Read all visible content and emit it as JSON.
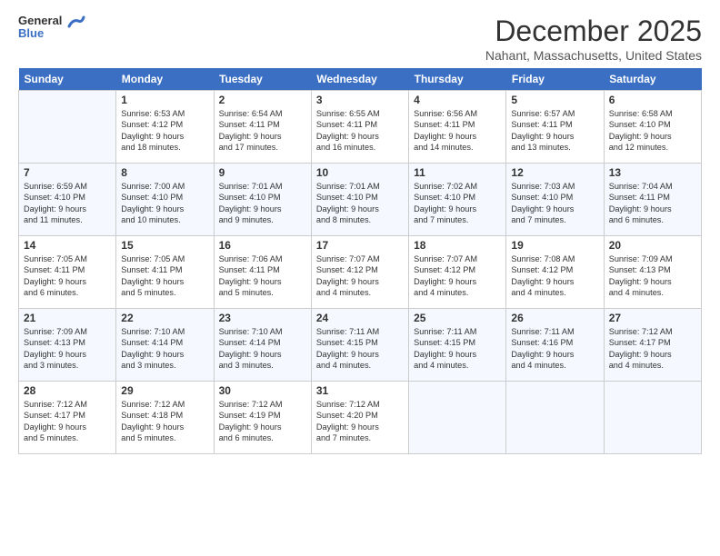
{
  "logo": {
    "general": "General",
    "blue": "Blue"
  },
  "title": "December 2025",
  "location": "Nahant, Massachusetts, United States",
  "days_of_week": [
    "Sunday",
    "Monday",
    "Tuesday",
    "Wednesday",
    "Thursday",
    "Friday",
    "Saturday"
  ],
  "weeks": [
    [
      {
        "day": "",
        "sunrise": "",
        "sunset": "",
        "daylight": ""
      },
      {
        "day": "1",
        "sunrise": "Sunrise: 6:53 AM",
        "sunset": "Sunset: 4:12 PM",
        "daylight": "Daylight: 9 hours and 18 minutes."
      },
      {
        "day": "2",
        "sunrise": "Sunrise: 6:54 AM",
        "sunset": "Sunset: 4:11 PM",
        "daylight": "Daylight: 9 hours and 17 minutes."
      },
      {
        "day": "3",
        "sunrise": "Sunrise: 6:55 AM",
        "sunset": "Sunset: 4:11 PM",
        "daylight": "Daylight: 9 hours and 16 minutes."
      },
      {
        "day": "4",
        "sunrise": "Sunrise: 6:56 AM",
        "sunset": "Sunset: 4:11 PM",
        "daylight": "Daylight: 9 hours and 14 minutes."
      },
      {
        "day": "5",
        "sunrise": "Sunrise: 6:57 AM",
        "sunset": "Sunset: 4:11 PM",
        "daylight": "Daylight: 9 hours and 13 minutes."
      },
      {
        "day": "6",
        "sunrise": "Sunrise: 6:58 AM",
        "sunset": "Sunset: 4:10 PM",
        "daylight": "Daylight: 9 hours and 12 minutes."
      }
    ],
    [
      {
        "day": "7",
        "sunrise": "Sunrise: 6:59 AM",
        "sunset": "Sunset: 4:10 PM",
        "daylight": "Daylight: 9 hours and 11 minutes."
      },
      {
        "day": "8",
        "sunrise": "Sunrise: 7:00 AM",
        "sunset": "Sunset: 4:10 PM",
        "daylight": "Daylight: 9 hours and 10 minutes."
      },
      {
        "day": "9",
        "sunrise": "Sunrise: 7:01 AM",
        "sunset": "Sunset: 4:10 PM",
        "daylight": "Daylight: 9 hours and 9 minutes."
      },
      {
        "day": "10",
        "sunrise": "Sunrise: 7:01 AM",
        "sunset": "Sunset: 4:10 PM",
        "daylight": "Daylight: 9 hours and 8 minutes."
      },
      {
        "day": "11",
        "sunrise": "Sunrise: 7:02 AM",
        "sunset": "Sunset: 4:10 PM",
        "daylight": "Daylight: 9 hours and 7 minutes."
      },
      {
        "day": "12",
        "sunrise": "Sunrise: 7:03 AM",
        "sunset": "Sunset: 4:10 PM",
        "daylight": "Daylight: 9 hours and 7 minutes."
      },
      {
        "day": "13",
        "sunrise": "Sunrise: 7:04 AM",
        "sunset": "Sunset: 4:11 PM",
        "daylight": "Daylight: 9 hours and 6 minutes."
      }
    ],
    [
      {
        "day": "14",
        "sunrise": "Sunrise: 7:05 AM",
        "sunset": "Sunset: 4:11 PM",
        "daylight": "Daylight: 9 hours and 6 minutes."
      },
      {
        "day": "15",
        "sunrise": "Sunrise: 7:05 AM",
        "sunset": "Sunset: 4:11 PM",
        "daylight": "Daylight: 9 hours and 5 minutes."
      },
      {
        "day": "16",
        "sunrise": "Sunrise: 7:06 AM",
        "sunset": "Sunset: 4:11 PM",
        "daylight": "Daylight: 9 hours and 5 minutes."
      },
      {
        "day": "17",
        "sunrise": "Sunrise: 7:07 AM",
        "sunset": "Sunset: 4:12 PM",
        "daylight": "Daylight: 9 hours and 4 minutes."
      },
      {
        "day": "18",
        "sunrise": "Sunrise: 7:07 AM",
        "sunset": "Sunset: 4:12 PM",
        "daylight": "Daylight: 9 hours and 4 minutes."
      },
      {
        "day": "19",
        "sunrise": "Sunrise: 7:08 AM",
        "sunset": "Sunset: 4:12 PM",
        "daylight": "Daylight: 9 hours and 4 minutes."
      },
      {
        "day": "20",
        "sunrise": "Sunrise: 7:09 AM",
        "sunset": "Sunset: 4:13 PM",
        "daylight": "Daylight: 9 hours and 4 minutes."
      }
    ],
    [
      {
        "day": "21",
        "sunrise": "Sunrise: 7:09 AM",
        "sunset": "Sunset: 4:13 PM",
        "daylight": "Daylight: 9 hours and 3 minutes."
      },
      {
        "day": "22",
        "sunrise": "Sunrise: 7:10 AM",
        "sunset": "Sunset: 4:14 PM",
        "daylight": "Daylight: 9 hours and 3 minutes."
      },
      {
        "day": "23",
        "sunrise": "Sunrise: 7:10 AM",
        "sunset": "Sunset: 4:14 PM",
        "daylight": "Daylight: 9 hours and 3 minutes."
      },
      {
        "day": "24",
        "sunrise": "Sunrise: 7:11 AM",
        "sunset": "Sunset: 4:15 PM",
        "daylight": "Daylight: 9 hours and 4 minutes."
      },
      {
        "day": "25",
        "sunrise": "Sunrise: 7:11 AM",
        "sunset": "Sunset: 4:15 PM",
        "daylight": "Daylight: 9 hours and 4 minutes."
      },
      {
        "day": "26",
        "sunrise": "Sunrise: 7:11 AM",
        "sunset": "Sunset: 4:16 PM",
        "daylight": "Daylight: 9 hours and 4 minutes."
      },
      {
        "day": "27",
        "sunrise": "Sunrise: 7:12 AM",
        "sunset": "Sunset: 4:17 PM",
        "daylight": "Daylight: 9 hours and 4 minutes."
      }
    ],
    [
      {
        "day": "28",
        "sunrise": "Sunrise: 7:12 AM",
        "sunset": "Sunset: 4:17 PM",
        "daylight": "Daylight: 9 hours and 5 minutes."
      },
      {
        "day": "29",
        "sunrise": "Sunrise: 7:12 AM",
        "sunset": "Sunset: 4:18 PM",
        "daylight": "Daylight: 9 hours and 5 minutes."
      },
      {
        "day": "30",
        "sunrise": "Sunrise: 7:12 AM",
        "sunset": "Sunset: 4:19 PM",
        "daylight": "Daylight: 9 hours and 6 minutes."
      },
      {
        "day": "31",
        "sunrise": "Sunrise: 7:12 AM",
        "sunset": "Sunset: 4:20 PM",
        "daylight": "Daylight: 9 hours and 7 minutes."
      },
      {
        "day": "",
        "sunrise": "",
        "sunset": "",
        "daylight": ""
      },
      {
        "day": "",
        "sunrise": "",
        "sunset": "",
        "daylight": ""
      },
      {
        "day": "",
        "sunrise": "",
        "sunset": "",
        "daylight": ""
      }
    ]
  ]
}
